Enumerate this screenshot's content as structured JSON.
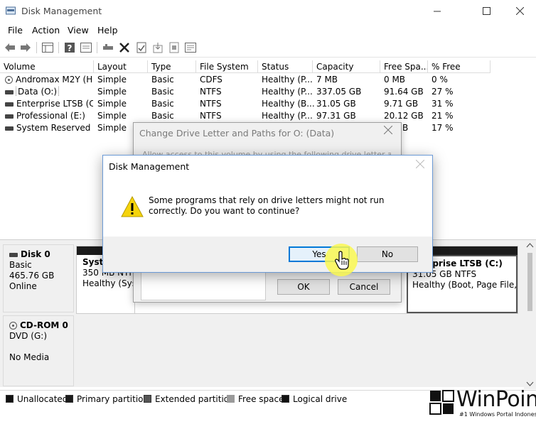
{
  "window": {
    "title": "Disk Management",
    "icon": "disk-management-icon"
  },
  "menu": [
    "File",
    "Action",
    "View",
    "Help"
  ],
  "toolbar_icons": [
    "back-arrow-icon",
    "forward-arrow-icon",
    "console-tree-icon",
    "help-icon",
    "properties-icon",
    "connect-icon",
    "delete-icon",
    "check-icon",
    "import-icon",
    "refresh-icon",
    "settings-icon"
  ],
  "columns": [
    "Volume",
    "Layout",
    "Type",
    "File System",
    "Status",
    "Capacity",
    "Free Spa...",
    "% Free"
  ],
  "volumes": [
    {
      "icon": "cd-icon",
      "name": "Andromax M2Y (H:)",
      "layout": "Simple",
      "type": "Basic",
      "fs": "CDFS",
      "status": "Healthy (P...",
      "capacity": "7 MB",
      "free": "0 MB",
      "pct": "0 %"
    },
    {
      "icon": "disk-icon",
      "name": "Data (O:)",
      "layout": "Simple",
      "type": "Basic",
      "fs": "NTFS",
      "status": "Healthy (P...",
      "capacity": "337.05 GB",
      "free": "91.64 GB",
      "pct": "27 %"
    },
    {
      "icon": "disk-icon",
      "name": "Enterprise LTSB (C:)",
      "layout": "Simple",
      "type": "Basic",
      "fs": "NTFS",
      "status": "Healthy (B...",
      "capacity": "31.05 GB",
      "free": "9.71 GB",
      "pct": "31 %"
    },
    {
      "icon": "disk-icon",
      "name": "Professional (E:)",
      "layout": "Simple",
      "type": "Basic",
      "fs": "NTFS",
      "status": "Healthy (P...",
      "capacity": "97.31 GB",
      "free": "20.12 GB",
      "pct": "21 %"
    },
    {
      "icon": "disk-icon",
      "name": "System Reserved",
      "layout": "Simple",
      "type": "",
      "fs": "",
      "status": "",
      "capacity": "",
      "free": "B",
      "pct": "17 %"
    }
  ],
  "disks": [
    {
      "name": "Disk 0",
      "type": "Basic",
      "size": "465.76 GB",
      "state": "Online"
    },
    {
      "name": "CD-ROM 0",
      "type": "DVD (G:)",
      "size": "",
      "state": "No Media"
    }
  ],
  "partitions": [
    {
      "title": "Syste",
      "size": "350 MB NTFS",
      "status": "Healthy (Syste"
    },
    {
      "title": "nterprise LTSB  (C:)",
      "size": "31.05 GB NTFS",
      "status": "Healthy (Boot, Page File, C"
    }
  ],
  "legend": [
    {
      "label": "Unallocated",
      "color": "#111111"
    },
    {
      "label": "Primary partition",
      "color": "#1b1b1b"
    },
    {
      "label": "Extended partition",
      "color": "#555555"
    },
    {
      "label": "Free space",
      "color": "#9a9a9a"
    },
    {
      "label": "Logical drive",
      "color": "#111111"
    }
  ],
  "bg_dialog": {
    "title": "Change Drive Letter and Paths for O: (Data)",
    "body": "Allow access to this volume by using the following drive letter and paths:",
    "ok": "OK",
    "cancel": "Cancel"
  },
  "fg_dialog": {
    "title": "Disk Management",
    "message": "Some programs that rely on drive letters might not run correctly. Do you want to continue?",
    "yes": "Yes",
    "no": "No",
    "icon": "warning-icon"
  },
  "watermark": {
    "brand": "WinPoin",
    "tagline": "#1 Windows Portal Indonesia"
  }
}
